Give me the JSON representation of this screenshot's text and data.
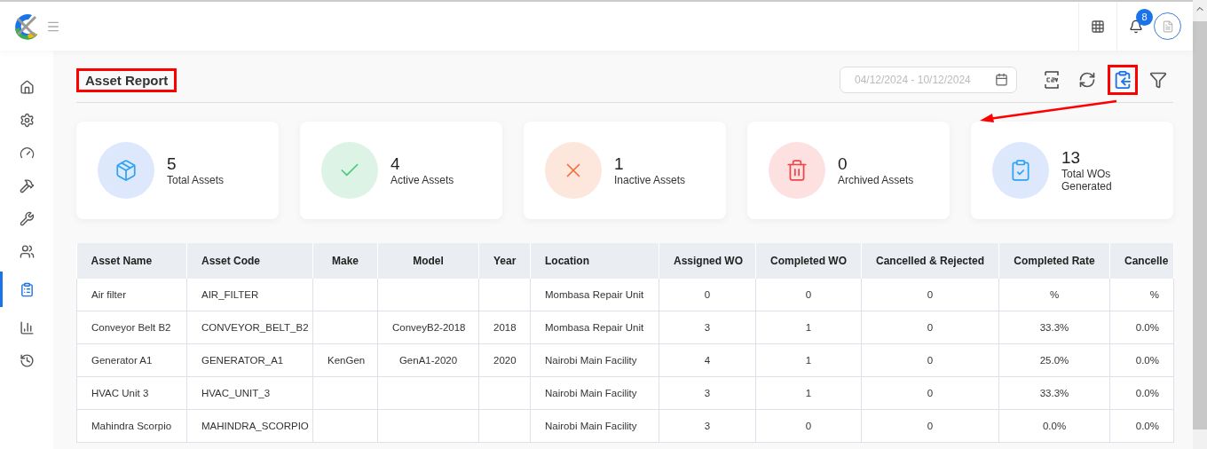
{
  "header": {
    "notifications": "8"
  },
  "sidebar": {
    "items": [
      {
        "selected": false
      },
      {
        "selected": false
      },
      {
        "selected": false
      },
      {
        "selected": false
      },
      {
        "selected": false
      },
      {
        "selected": false
      },
      {
        "selected": true
      },
      {
        "selected": false
      },
      {
        "selected": false
      }
    ]
  },
  "page": {
    "title": "Asset Report",
    "title_highlighted": true,
    "date_range": {
      "placeholder": "04/12/2024 - 10/12/2024"
    },
    "toolbar": [
      {
        "highlighted": false
      },
      {
        "highlighted": false
      },
      {
        "highlighted": true
      },
      {
        "highlighted": false
      }
    ]
  },
  "stats": [
    {
      "kind": "box",
      "value": "5",
      "label": "Total Assets"
    },
    {
      "kind": "check",
      "value": "4",
      "label": "Active Assets"
    },
    {
      "kind": "cross",
      "value": "1",
      "label": "Inactive Assets"
    },
    {
      "kind": "trash",
      "value": "0",
      "label": "Archived Assets"
    },
    {
      "kind": "clipboard",
      "value": "13",
      "label": "Total WOs Generated"
    }
  ],
  "table": {
    "columns": [
      "Asset Name",
      "Asset Code",
      "Make",
      "Model",
      "Year",
      "Location",
      "Assigned WO",
      "Completed WO",
      "Cancelled & Rejected",
      "Completed Rate",
      "Cancelle"
    ],
    "rows": [
      [
        "Air filter",
        "AIR_FILTER",
        "",
        "",
        "",
        "Mombasa Repair Unit",
        "0",
        "0",
        "0",
        "%",
        "%"
      ],
      [
        "Conveyor Belt B2",
        "CONVEYOR_BELT_B2",
        "",
        "ConveyB2-2018",
        "2018",
        "Mombasa Repair Unit",
        "3",
        "1",
        "0",
        "33.3%",
        "0.0%"
      ],
      [
        "Generator A1",
        "GENERATOR_A1",
        "KenGen",
        "GenA1-2020",
        "2020",
        "Nairobi Main Facility",
        "4",
        "1",
        "0",
        "25.0%",
        "0.0%"
      ],
      [
        "HVAC Unit 3",
        "HVAC_UNIT_3",
        "",
        "",
        "",
        "Nairobi Main Facility",
        "3",
        "1",
        "0",
        "33.3%",
        "0.0%"
      ],
      [
        "Mahindra Scorpio",
        "MAHINDRA_SCORPIO",
        "",
        "",
        "",
        "Nairobi Main Facility",
        "3",
        "0",
        "0",
        "0.0%",
        "0.0%"
      ]
    ]
  }
}
